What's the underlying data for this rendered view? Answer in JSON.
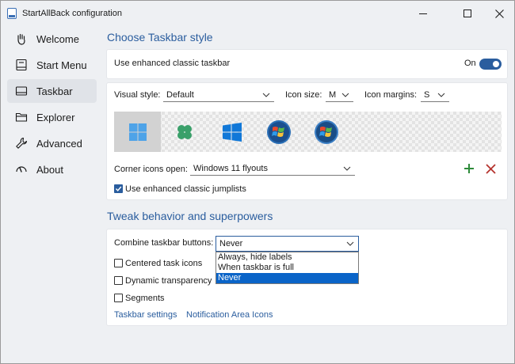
{
  "window": {
    "title": "StartAllBack configuration"
  },
  "sidebar": {
    "items": [
      {
        "label": "Welcome",
        "icon": "hand-wave-icon"
      },
      {
        "label": "Start Menu",
        "icon": "start-menu-icon"
      },
      {
        "label": "Taskbar",
        "icon": "taskbar-icon",
        "active": true
      },
      {
        "label": "Explorer",
        "icon": "folder-icon"
      },
      {
        "label": "Advanced",
        "icon": "wrench-icon"
      },
      {
        "label": "About",
        "icon": "info-icon"
      }
    ]
  },
  "taskbar_style": {
    "section_title": "Choose Taskbar style",
    "enhanced_label": "Use enhanced classic taskbar",
    "toggle_state": "On",
    "visual_style_label": "Visual style:",
    "visual_style_value": "Default",
    "icon_size_label": "Icon size:",
    "icon_size_value": "M",
    "icon_margins_label": "Icon margins:",
    "icon_margins_value": "S",
    "corner_icons_label": "Corner icons open:",
    "corner_icons_value": "Windows 11 flyouts",
    "jumplists_label": "Use enhanced classic jumplists",
    "jumplists_checked": true
  },
  "tweak": {
    "section_title": "Tweak behavior and superpowers",
    "combine_label": "Combine taskbar buttons:",
    "combine_value": "Never",
    "combine_options": [
      "Always, hide labels",
      "When taskbar is full",
      "Never"
    ],
    "centered_label": "Centered task icons",
    "dynamic_label": "Dynamic transparency",
    "segments_label": "Segments",
    "link_taskbar_settings": "Taskbar settings",
    "link_notification_icons": "Notification Area Icons"
  },
  "colors": {
    "accent": "#2a5d9e",
    "selection": "#0a64c8",
    "add_green": "#2e8b3a",
    "remove_red": "#b5332e"
  }
}
